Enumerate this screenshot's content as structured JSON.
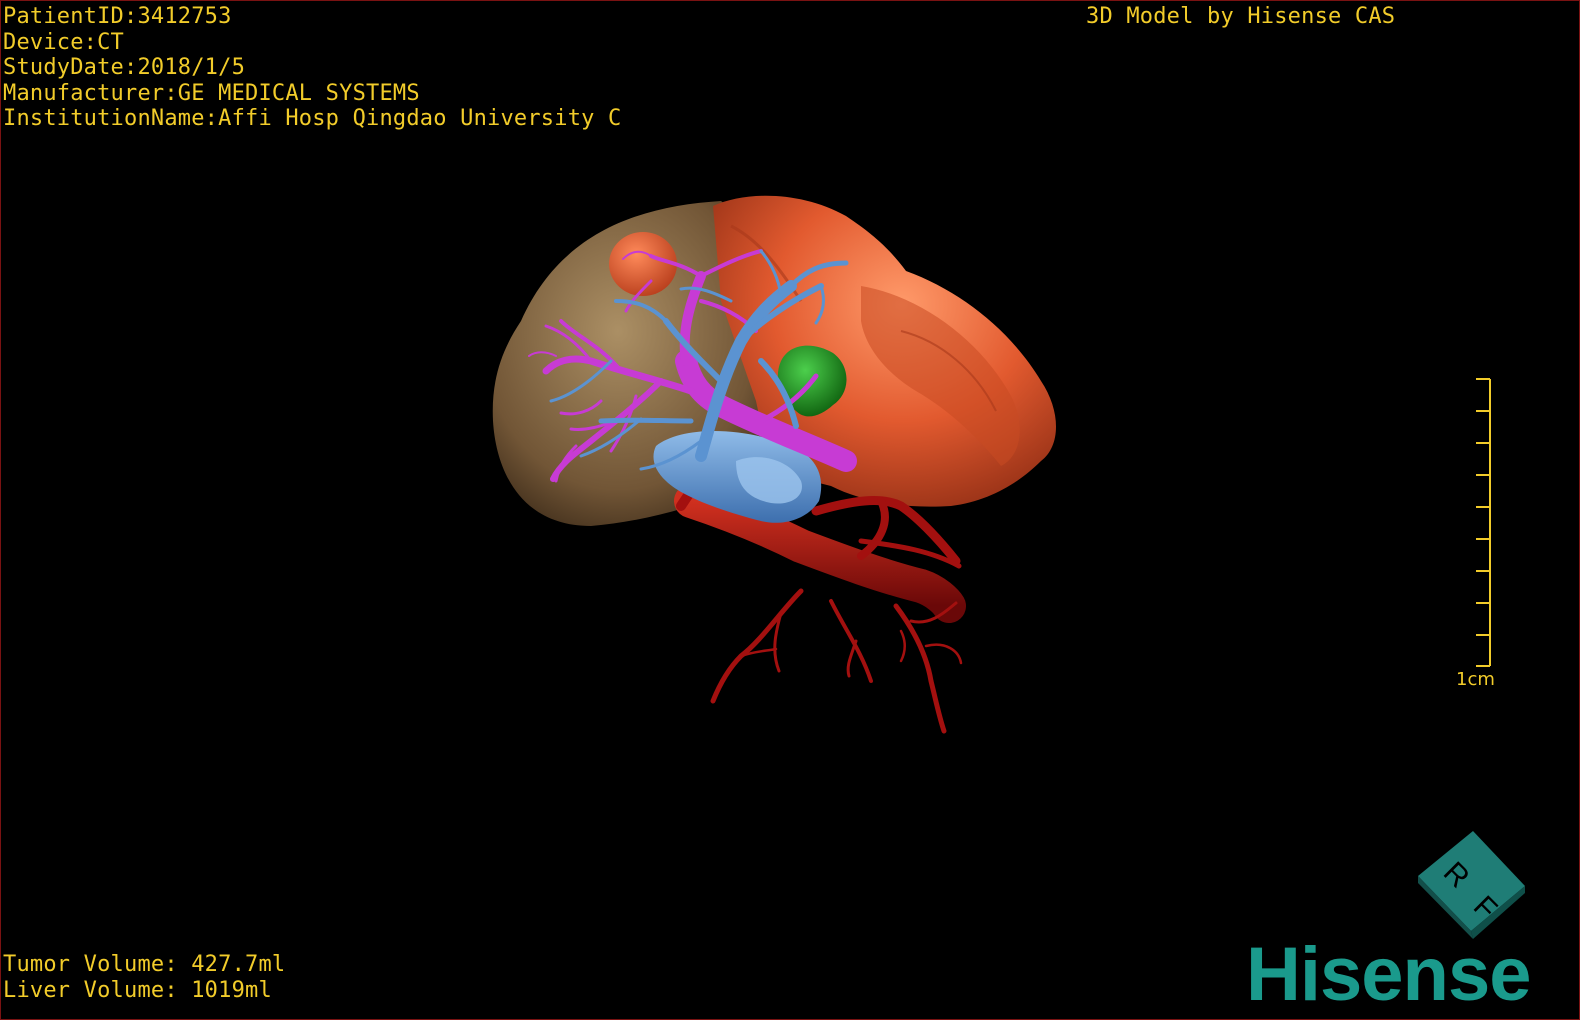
{
  "header": {
    "patient_id": "PatientID:3412753",
    "device": "Device:CT",
    "study_date": "StudyDate:2018/1/5",
    "manufacturer": "Manufacturer:GE MEDICAL SYSTEMS",
    "institution": "InstitutionName:Affi Hosp Qingdao University C",
    "credit": "3D Model by Hisense CAS"
  },
  "volumes": {
    "tumor": "Tumor Volume: 427.7ml",
    "liver": "Liver Volume: 1019ml"
  },
  "scale_bar": {
    "label": "1cm"
  },
  "orientation_cube": {
    "face_top": "R",
    "face_front": "F"
  },
  "brand": {
    "name": "Hisense"
  },
  "colors": {
    "overlay_text": "#f2cc2a",
    "liver_right_lobe": "#e0582f",
    "liver_left_translucent": "#8a6a45",
    "hepatic_vein": "#5b93d1",
    "portal_vein": "#c73bd4",
    "artery": "#a3100f",
    "tumor": "#1e8f1e",
    "brand": "#1a9a8c"
  }
}
